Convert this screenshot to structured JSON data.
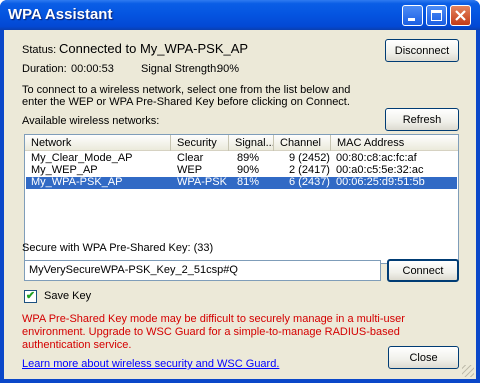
{
  "window": {
    "title": "WPA Assistant",
    "controls": {
      "minimize": "—",
      "maximize": "□",
      "close": "✕"
    }
  },
  "status": {
    "label": "Status:",
    "value": "Connected to My_WPA-PSK_AP",
    "duration_label": "Duration:",
    "duration": "00:00:53",
    "signal_label": "Signal Strength:",
    "signal": "90%"
  },
  "buttons": {
    "disconnect": "Disconnect",
    "refresh": "Refresh",
    "connect": "Connect",
    "close": "Close"
  },
  "instructions": {
    "line1": "To connect to a wireless network, select one from the list below and",
    "line2": "enter the WEP or WPA Pre-Shared Key before clicking on Connect."
  },
  "networks": {
    "label": "Available wireless networks:",
    "columns": [
      "Network",
      "Security ...",
      "Signal...",
      "Channel ...",
      "MAC Address"
    ],
    "rows": [
      {
        "network": "My_Clear_Mode_AP",
        "security": "Clear",
        "signal": "89%",
        "channel": "9 (2452)",
        "mac": "00:80:c8:ac:fc:af"
      },
      {
        "network": "My_WEP_AP",
        "security": "WEP",
        "signal": "90%",
        "channel": "2 (2417)",
        "mac": "00:a0:c5:5e:32:ac"
      },
      {
        "network": "My_WPA-PSK_AP",
        "security": "WPA-PSK",
        "signal": "81%",
        "channel": "6 (2437)",
        "mac": "00:06:25:d9:51:5b"
      }
    ],
    "selected_index": 2
  },
  "key": {
    "label": "Secure with WPA Pre-Shared Key: (33)",
    "value": "MyVerySecureWPA-PSK_Key_2_51csp#Q",
    "save_label": "Save Key",
    "save_checked": true,
    "check_glyph": "✔"
  },
  "warning": {
    "line1": "WPA Pre-Shared Key mode may be difficult to securely manage in a multi-user",
    "line2": "environment.  Upgrade to WSC Guard for a simple-to-manage RADIUS-based",
    "line3": "authentication service."
  },
  "learn_more": "Learn more about wireless security and WSC Guard.",
  "colors": {
    "titlebar": "#0454e0",
    "client_bg": "#ece9d8",
    "selection": "#316ac5",
    "warning_text": "#d40000",
    "link": "#0000ff"
  }
}
